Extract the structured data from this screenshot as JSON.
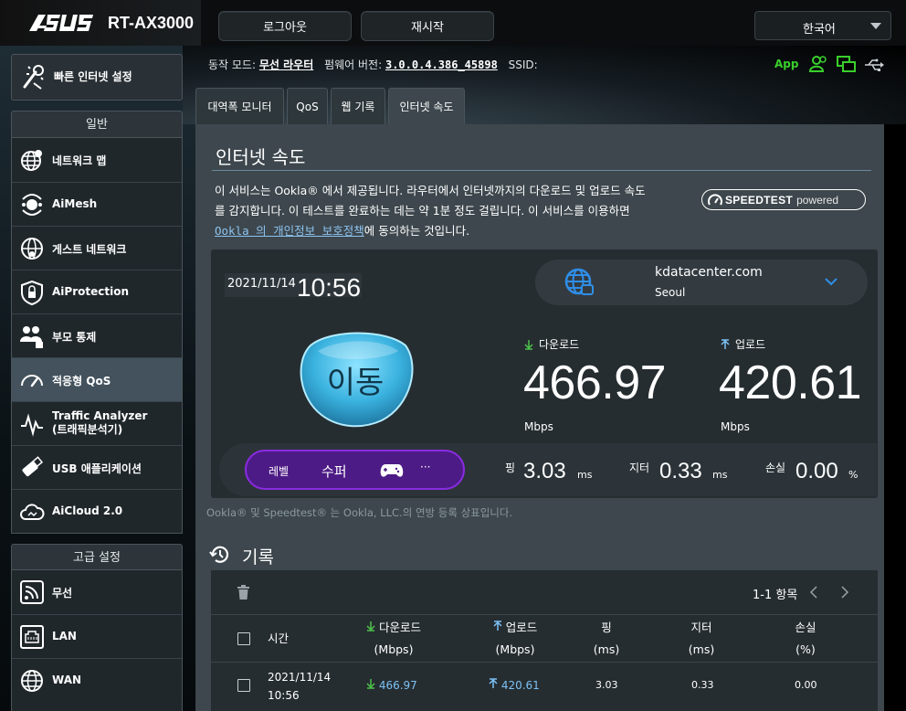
{
  "header": {
    "brand": "/ISUS",
    "model": "RT-AX3000",
    "logout_label": "로그아웃",
    "reboot_label": "재시작",
    "language": "한국어"
  },
  "status": {
    "mode_label": "동작 모드:",
    "mode_value": "무선 라우터",
    "firmware_label": "펌웨어 버전:",
    "firmware_value": "3.0.0.4.386_45898",
    "ssid_label": "SSID:",
    "app_label": "App"
  },
  "sidebar": {
    "quick_setup": "빠른 인터넷 설정",
    "general_title": "일반",
    "general_items": [
      {
        "label": "네트워크 맵"
      },
      {
        "label": "AiMesh"
      },
      {
        "label": "게스트 네트워크"
      },
      {
        "label": "AiProtection"
      },
      {
        "label": "부모 통제"
      },
      {
        "label": "적응형 QoS"
      },
      {
        "label": "Traffic Analyzer",
        "sub": "(트래픽분석기)"
      },
      {
        "label": "USB 애플리케이션"
      },
      {
        "label": "AiCloud 2.0"
      }
    ],
    "advanced_title": "고급 설정",
    "advanced_items": [
      {
        "label": "무선"
      },
      {
        "label": "LAN"
      },
      {
        "label": "WAN"
      }
    ]
  },
  "tabs": [
    {
      "label": "대역폭 모니터"
    },
    {
      "label": "QoS"
    },
    {
      "label": "웹 기록"
    },
    {
      "label": "인터넷 속도"
    }
  ],
  "page": {
    "title": "인터넷 속도",
    "intro_1": "이 서비스는 Ookla® 에서 제공됩니다. 라우터에서 인터넷까지의 다운로드 및 업로드 속도",
    "intro_2": "를 감지합니다. 이 테스트를 완료하는 데는 약 1분 정도 걸립니다. 이 서비스를 이용하면",
    "intro_link": "Ookla 의 개인정보 보호정책",
    "intro_3": "에 동의하는 것입니다.",
    "badge_speedtest": "SPEEDTEST",
    "badge_powered": "powered",
    "trademark": "Ookla® 및 Speedtest® 는 Ookla, LLC.의 연방 등록 상표입니다."
  },
  "result": {
    "date": "2021/11/14",
    "time": "10:56",
    "server_name": "kdatacenter.com",
    "server_city": "Seoul",
    "go_label": "이동",
    "download_label": "다운로드",
    "download_value": "466.97",
    "upload_label": "업로드",
    "upload_value": "420.61",
    "unit_mbps": "Mbps",
    "level_label": "레벨",
    "level_value": "수퍼",
    "level_more": "···",
    "ping_label": "핑",
    "ping_value": "3.03",
    "jitter_label": "지터",
    "jitter_value": "0.33",
    "loss_label": "손실",
    "loss_value": "0.00",
    "unit_ms": "ms",
    "unit_pct": "%"
  },
  "history": {
    "title": "기록",
    "pager": "1-1 항목",
    "columns": {
      "time": "시간",
      "download": "다운로드",
      "download_unit": "(Mbps)",
      "upload": "업로드",
      "upload_unit": "(Mbps)",
      "ping": "핑",
      "ping_unit": "(ms)",
      "jitter": "지터",
      "jitter_unit": "(ms)",
      "loss": "손실",
      "loss_unit": "(%)"
    },
    "rows": [
      {
        "date": "2021/11/14",
        "time": "10:56",
        "download": "466.97",
        "upload": "420.61",
        "ping": "3.03",
        "jitter": "0.33",
        "loss": "0.00"
      }
    ]
  },
  "colors": {
    "accent_green": "#39d02c",
    "link_blue": "#8dc3ef",
    "level_purple": "#4d1b86",
    "panel": "#3d474d"
  }
}
